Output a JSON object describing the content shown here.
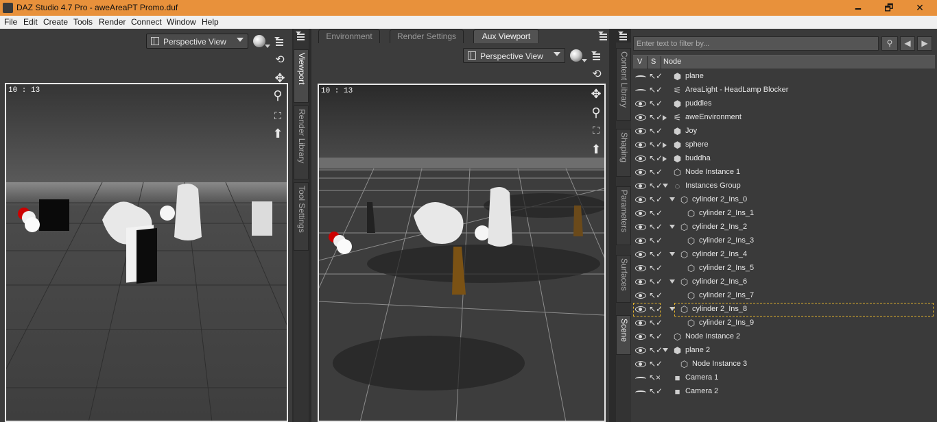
{
  "window": {
    "title": "DAZ Studio 4.7 Pro - aweAreaPT Promo.duf",
    "minimize": "🗕",
    "maximize": "🗗",
    "close": "✕"
  },
  "menu": [
    "File",
    "Edit",
    "Create",
    "Tools",
    "Render",
    "Connect",
    "Window",
    "Help"
  ],
  "left_viewport": {
    "view_select": "Perspective View",
    "timecode": "10 : 13"
  },
  "left_tabs": [
    "Viewport",
    "Render Library",
    "Tool Settings"
  ],
  "center_tabs": [
    "Environment",
    "Render Settings",
    "Aux Viewport"
  ],
  "center_viewport": {
    "view_select": "Perspective View",
    "timecode": "10 : 13"
  },
  "right_tabs": [
    "Content Library",
    "Shaping",
    "Parameters",
    "Surfaces",
    "Scene"
  ],
  "scene": {
    "filter_placeholder": "Enter text to filter by...",
    "columns": {
      "v": "V",
      "s": "S",
      "node": "Node"
    },
    "nodes": [
      {
        "label": "plane",
        "depth": 0,
        "expand": "none",
        "icon": "cube-icon",
        "eye": "closed"
      },
      {
        "label": "AreaLight - HeadLamp Blocker",
        "depth": 0,
        "expand": "none",
        "icon": "light-icon",
        "eye": "closed"
      },
      {
        "label": "puddles",
        "depth": 0,
        "expand": "none",
        "icon": "cube-icon",
        "eye": "open"
      },
      {
        "label": "aweEnvironment",
        "depth": 0,
        "expand": "closed",
        "icon": "light-icon",
        "eye": "open"
      },
      {
        "label": "Joy",
        "depth": 0,
        "expand": "none",
        "icon": "cube-icon",
        "eye": "open"
      },
      {
        "label": "sphere",
        "depth": 0,
        "expand": "closed",
        "icon": "cube-icon",
        "eye": "open"
      },
      {
        "label": "buddha",
        "depth": 0,
        "expand": "closed",
        "icon": "cube-icon",
        "eye": "open"
      },
      {
        "label": "Node Instance 1",
        "depth": 0,
        "expand": "none",
        "icon": "instance-icon",
        "eye": "open"
      },
      {
        "label": "Instances Group",
        "depth": 0,
        "expand": "open",
        "icon": "group-icon",
        "eye": "open"
      },
      {
        "label": "cylinder 2_Ins_0",
        "depth": 1,
        "expand": "open",
        "icon": "instance-icon",
        "eye": "open"
      },
      {
        "label": "cylinder 2_Ins_1",
        "depth": 2,
        "expand": "none",
        "icon": "instance-icon",
        "eye": "open"
      },
      {
        "label": "cylinder 2_Ins_2",
        "depth": 1,
        "expand": "open",
        "icon": "instance-icon",
        "eye": "open"
      },
      {
        "label": "cylinder 2_Ins_3",
        "depth": 2,
        "expand": "none",
        "icon": "instance-icon",
        "eye": "open"
      },
      {
        "label": "cylinder 2_Ins_4",
        "depth": 1,
        "expand": "open",
        "icon": "instance-icon",
        "eye": "open"
      },
      {
        "label": "cylinder 2_Ins_5",
        "depth": 2,
        "expand": "none",
        "icon": "instance-icon",
        "eye": "open"
      },
      {
        "label": "cylinder 2_Ins_6",
        "depth": 1,
        "expand": "open",
        "icon": "instance-icon",
        "eye": "open"
      },
      {
        "label": "cylinder 2_Ins_7",
        "depth": 2,
        "expand": "none",
        "icon": "instance-icon",
        "eye": "open"
      },
      {
        "label": "cylinder 2_Ins_8",
        "depth": 1,
        "expand": "open",
        "icon": "instance-icon",
        "eye": "open",
        "selected": true
      },
      {
        "label": "cylinder 2_Ins_9",
        "depth": 2,
        "expand": "none",
        "icon": "instance-icon",
        "eye": "open"
      },
      {
        "label": "Node Instance 2",
        "depth": 0,
        "expand": "none",
        "icon": "instance-icon",
        "eye": "open"
      },
      {
        "label": "plane 2",
        "depth": 0,
        "expand": "open",
        "icon": "cube-icon",
        "eye": "open"
      },
      {
        "label": "Node Instance 3",
        "depth": 1,
        "expand": "none",
        "icon": "instance-icon",
        "eye": "open"
      },
      {
        "label": "Camera 1",
        "depth": 0,
        "expand": "none",
        "icon": "camera-icon",
        "eye": "closed",
        "sel_x": true
      },
      {
        "label": "Camera 2",
        "depth": 0,
        "expand": "none",
        "icon": "camera-icon",
        "eye": "closed"
      }
    ]
  },
  "colors": {
    "titlebar": "#e8913b",
    "selection": "#e1b12c"
  }
}
